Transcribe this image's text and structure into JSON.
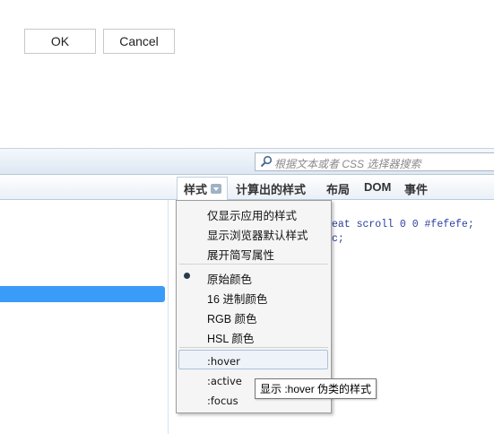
{
  "dialog": {
    "ok_label": "OK",
    "cancel_label": "Cancel"
  },
  "search": {
    "placeholder": "根据文本或者 CSS 选择器搜索"
  },
  "tabs": [
    {
      "label": "样式"
    },
    {
      "label": "计算出的样式"
    },
    {
      "label": "布局"
    },
    {
      "label": "DOM"
    },
    {
      "label": "事件"
    }
  ],
  "code": {
    "line1": "eat scroll 0 0 #fefefe;",
    "line2": "c;"
  },
  "menu": {
    "items": [
      {
        "label": "仅显示应用的样式"
      },
      {
        "label": "显示浏览器默认样式"
      },
      {
        "label": "展开简写属性"
      },
      {
        "label": "原始颜色",
        "checked": true
      },
      {
        "label": "16 进制颜色"
      },
      {
        "label": "RGB 颜色"
      },
      {
        "label": "HSL 颜色"
      },
      {
        "label": ":hover"
      },
      {
        "label": ":active"
      },
      {
        "label": ":focus"
      }
    ]
  },
  "tooltip": {
    "text": "显示 :hover 伪类的样式"
  },
  "colors": {
    "accent": "#3a9cf8",
    "code": "#2a3f9e"
  },
  "icons": {
    "search": "magnifier-icon",
    "dropdown": "chevron-down-icon",
    "radio": "radio-dot-icon"
  }
}
